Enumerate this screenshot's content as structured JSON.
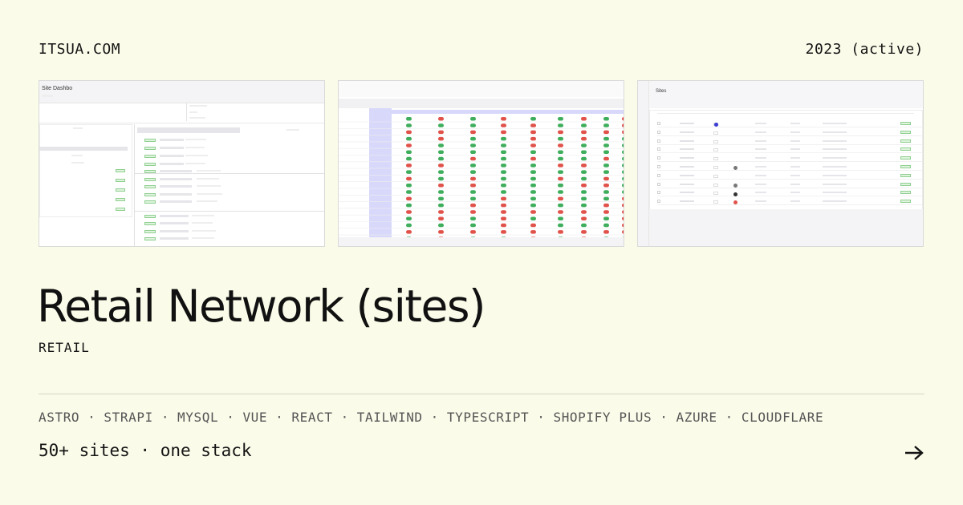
{
  "header": {
    "domain": "ITSUA.COM",
    "year": "2023 (active)"
  },
  "project": {
    "title": "Retail Network (sites)",
    "category": "RETAIL",
    "tagline": "50+ sites · one stack"
  },
  "stack": [
    "ASTRO",
    "STRAPI",
    "MYSQL",
    "VUE",
    "REACT",
    "TAILWIND",
    "TYPESCRIPT",
    "SHOPIFY PLUS",
    "AZURE",
    "CLOUDFLARE"
  ],
  "screenshots": [
    {
      "name": "sites-dashboard",
      "label": "Site Dashbo"
    },
    {
      "name": "feature-toggle-matrix",
      "label": ""
    },
    {
      "name": "sites-list",
      "label": "Sites"
    }
  ],
  "colors": {
    "background": "#fbfbea",
    "text": "#141414",
    "muted": "#555555",
    "toggle_on": "#3fae5c",
    "toggle_off": "#e0524a",
    "matrix_highlight": "#d8d8fb"
  },
  "icons": {
    "cta": "arrow-right-icon"
  }
}
